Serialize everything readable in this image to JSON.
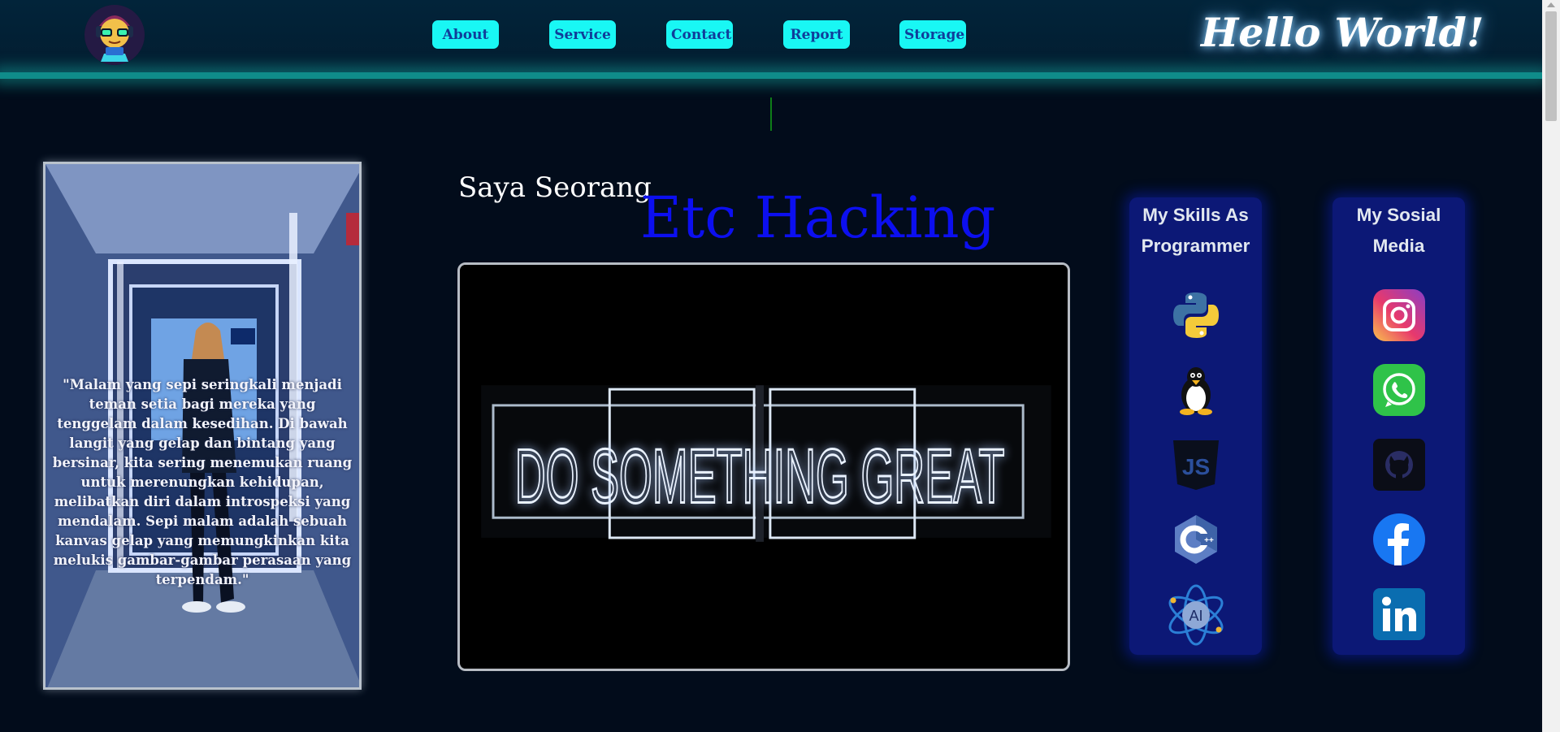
{
  "header": {
    "logo_icon": "hacker-cartoon-avatar",
    "nav": [
      {
        "label": "About"
      },
      {
        "label": "Service"
      },
      {
        "label": "Contact"
      },
      {
        "label": "Report"
      },
      {
        "label": "Storage"
      }
    ],
    "greeting": "Hello World!"
  },
  "hero": {
    "quote": "\"Malam yang sepi seringkali menjadi teman setia bagi mereka yang tenggelam dalam kesedihan. Di bawah langit yang gelap dan bintang yang bersinar, kita sering menemukan ruang untuk merenungkan kehidupan, melibatkan diri dalam introspeksi yang mendalam. Sepi malam adalah sebuah kanvas gelap yang memungkinkan kita melukis gambar-gambar perasaan yang terpendam.\"",
    "intro": "Saya Seorang",
    "role": "Etc Hacking",
    "neon_sign": "DO SOMETHING GREAT"
  },
  "skills": {
    "title": "My Skills As Programmer",
    "icons": [
      "python-icon",
      "linux-icon",
      "javascript-icon",
      "cpp-icon",
      "ai-icon"
    ]
  },
  "social": {
    "title": "My Sosial Media",
    "icons": [
      "instagram-icon",
      "whatsapp-icon",
      "github-icon",
      "facebook-icon",
      "linkedin-icon"
    ]
  },
  "colors": {
    "nav_button_bg": "#19f7f4",
    "nav_button_text": "#103d9a",
    "role_text": "#0c0ff0",
    "panel_bg": "#0c1876",
    "page_bg": "#020c1b"
  }
}
